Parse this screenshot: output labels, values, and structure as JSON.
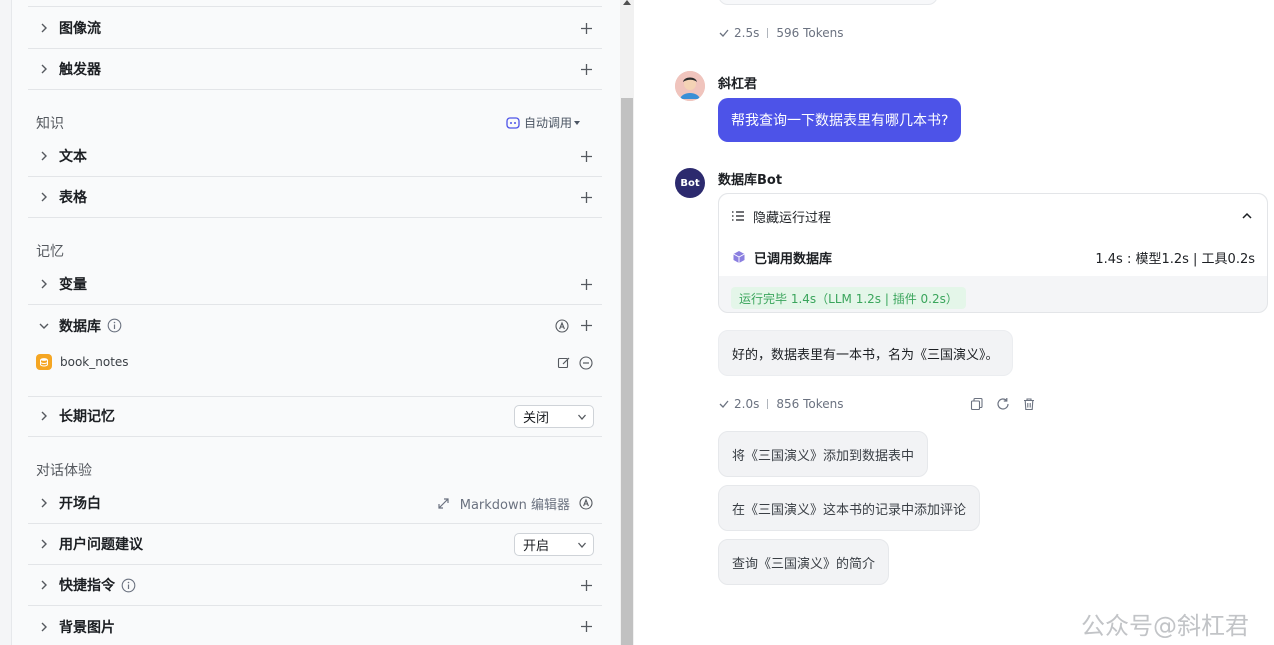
{
  "left_panel": {
    "rows": {
      "image_flow": "图像流",
      "trigger": "触发器",
      "text": "文本",
      "table": "表格",
      "variable": "变量",
      "database": "数据库",
      "long_term_memory": "长期记忆",
      "opening": "开场白",
      "user_question_suggestion": "用户问题建议",
      "shortcut": "快捷指令",
      "background_image": "背景图片"
    },
    "sections": {
      "knowledge": "知识",
      "memory": "记忆",
      "dialog_experience": "对话体验"
    },
    "auto_call": "自动调用",
    "database_item": "book_notes",
    "long_term_memory_select": "关闭",
    "user_question_suggestion_select": "开启",
    "markdown_editor": "Markdown 编辑器"
  },
  "chat": {
    "top_meta": {
      "time": "2.5s",
      "tokens": "596 Tokens"
    },
    "user_name": "斜杠君",
    "user_message": "帮我查询一下数据表里有哪几本书?",
    "bot_name": "数据库Bot",
    "bot_avatar_text": "Bot",
    "process": {
      "toggle_label": "隐藏运行过程",
      "db_call_label": "已调用数据库",
      "db_call_timing": "1.4s : 模型1.2s | 工具0.2s",
      "done_label": "运行完毕 1.4s（LLM 1.2s | 插件 0.2s）"
    },
    "bot_reply": "好的，数据表里有一本书，名为《三国演义》。",
    "reply_meta": {
      "time": "2.0s",
      "tokens": "856 Tokens"
    },
    "suggestions": [
      "将《三国演义》添加到数据表中",
      "在《三国演义》这本书的记录中添加评论",
      "查询《三国演义》的简介"
    ],
    "watermark": "公众号@斜杠君"
  },
  "colors": {
    "accent": "#4d53e8",
    "bot_avatar": "#2c2a6e",
    "success_bg": "#e4f6e9",
    "success_text": "#3aa55c",
    "db_icon": "#f5a623"
  },
  "icons": [
    "chevron-right-icon",
    "chevron-down-icon",
    "plus-icon",
    "info-icon",
    "bot-icon",
    "auto-icon",
    "edit-icon",
    "remove-icon",
    "expand-icon",
    "list-icon",
    "chevron-up-icon",
    "cube-icon",
    "check-icon",
    "copy-icon",
    "refresh-icon",
    "trash-icon",
    "database-icon"
  ]
}
